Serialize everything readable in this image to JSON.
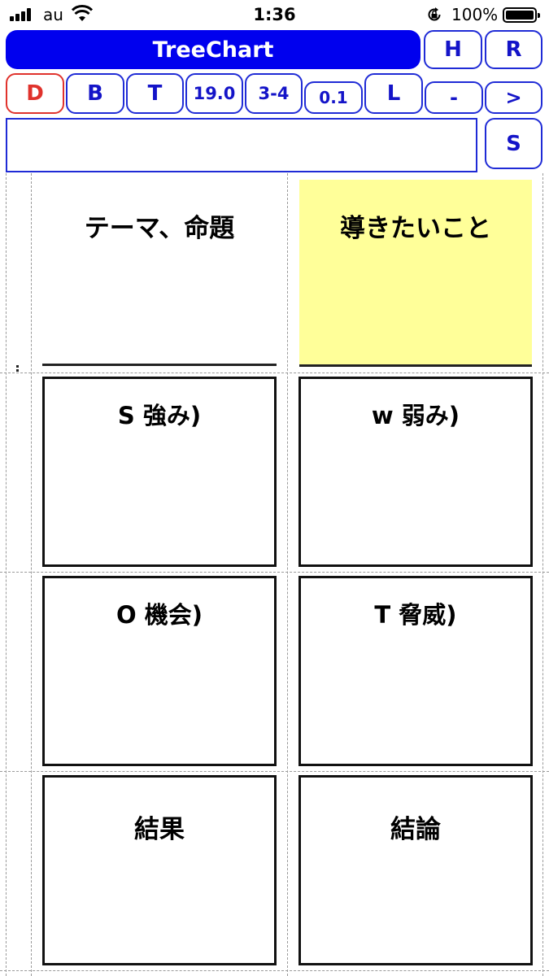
{
  "status_bar": {
    "carrier": "au",
    "time": "1:36",
    "battery_percent": "100%",
    "icons": [
      "signal-bars-icon",
      "wifi-icon",
      "rotation-lock-icon",
      "battery-icon"
    ]
  },
  "toolbar": {
    "title": "TreeChart",
    "row1": {
      "h": "H",
      "r": "R"
    },
    "row2": {
      "d": "D",
      "b": "B",
      "t": "T",
      "font_size": "19.0",
      "ratio": "3-4",
      "step": "0.1",
      "l": "L",
      "minus": "-",
      "next": ">"
    },
    "s": "S"
  },
  "input": {
    "value": "",
    "placeholder": ""
  },
  "chart": {
    "theme": "テーマ、命題",
    "goal": "導きたいこと",
    "strengths": "S 強み)",
    "weaknesses": "w 弱み)",
    "opportunities": "O 機会)",
    "threats": "T 脅威)",
    "result": "結果",
    "conclusion": "結論"
  },
  "colors": {
    "accent_blue": "#0000ee",
    "button_text_blue": "#1414c8",
    "selected_red": "#e0322c",
    "goal_yellow": "#ffff99"
  }
}
